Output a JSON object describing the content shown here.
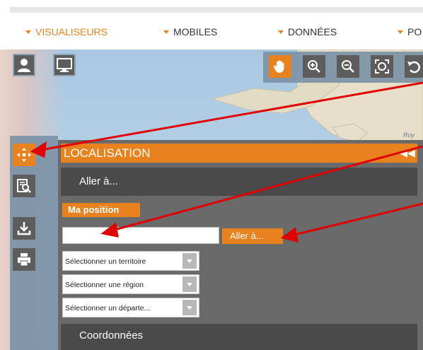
{
  "nav": {
    "items": [
      {
        "label": "VISUALISEURS",
        "active": true
      },
      {
        "label": "MOBILES",
        "active": false
      },
      {
        "label": "DONNÉES",
        "active": false
      },
      {
        "label": "PO",
        "active": false
      }
    ]
  },
  "map": {
    "place_label": "Roy"
  },
  "top_buttons": [
    "user-icon",
    "monitor-icon"
  ],
  "toolbar": {
    "tools": [
      "pan-hand-icon",
      "zoom-in-icon",
      "zoom-out-icon",
      "zoom-extent-icon",
      "undo-icon"
    ],
    "active_tool": "pan-hand-icon"
  },
  "side_panel": {
    "buttons": [
      "localisation-icon",
      "search-layers-icon",
      "download-icon",
      "print-icon"
    ],
    "active_button": "localisation-icon"
  },
  "localisation": {
    "title": "LOCALISATION",
    "goto_section": "Aller à...",
    "my_position_label": "Ma position",
    "address_input_value": "",
    "go_button_label": "Aller à...",
    "territory_select": "Sélectionner un territoire",
    "region_select": "Sélectionner une région",
    "department_select": "Sélectionner un départe...",
    "coords_section": "Coordonnées"
  },
  "colors": {
    "accent": "#e8821e",
    "panel_dark": "#4a4a4a",
    "panel_mid": "#6a6a6a",
    "annotation_arrow": "#e00000"
  }
}
